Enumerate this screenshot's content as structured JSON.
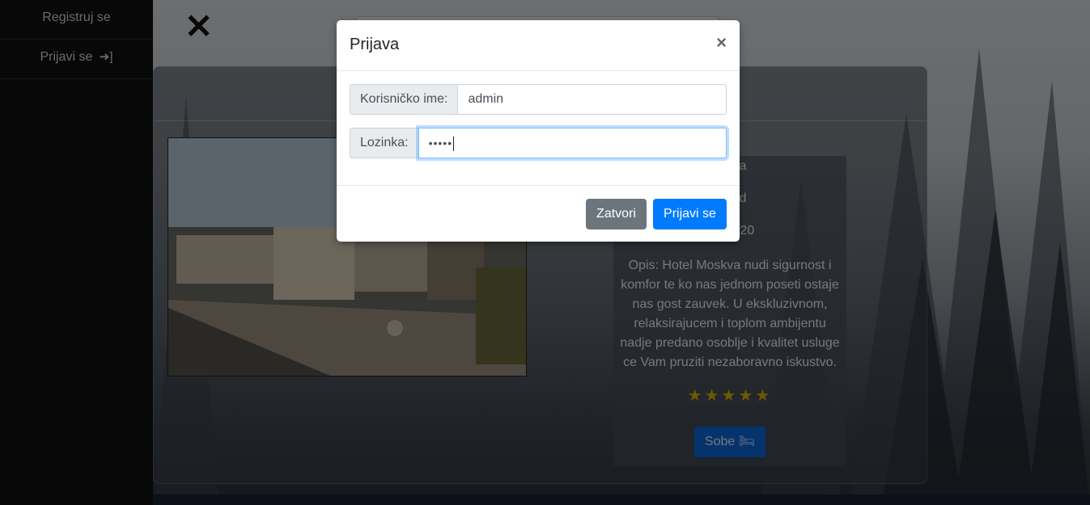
{
  "sidebar": {
    "items": [
      {
        "label": "Registruj se"
      },
      {
        "label": "Prijavi se",
        "icon": "sign-in-icon"
      }
    ]
  },
  "page": {
    "close_icon": "close-icon",
    "info_lines": [
      "Srbija",
      "ograd",
      "razije 20"
    ],
    "description": "Opis: Hotel Moskva nudi sigurnost i komfor te ko nas jednom poseti ostaje nas gost zauvek. U ekskluzivnom, relaksirajucem i toplom ambijentu nadje predano osoblje i kvalitet usluge ce Vam pruziti nezaboravno iskustvo.",
    "rating": 5,
    "sobe_label": "Sobe",
    "sobe_icon": "bed-icon"
  },
  "modal": {
    "title": "Prijava",
    "close_symbol": "×",
    "username_label": "Korisničko ime:",
    "username_value": "admin",
    "password_label": "Lozinka:",
    "password_value": "•••••",
    "close_button": "Zatvori",
    "submit_button": "Prijavi se"
  },
  "colors": {
    "primary": "#007bff",
    "secondary": "#6c757d",
    "star": "#e0b100"
  }
}
